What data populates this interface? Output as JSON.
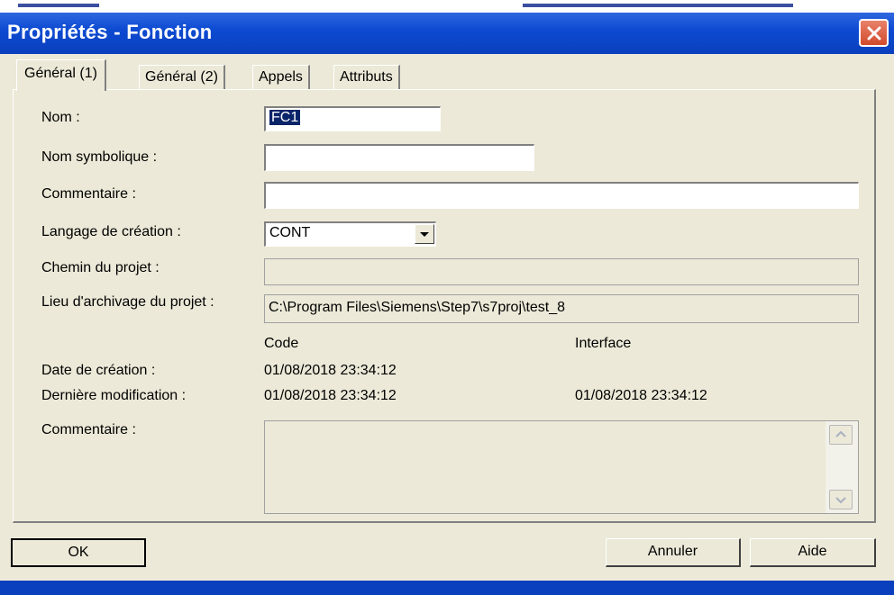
{
  "window": {
    "title": "Propriétés - Fonction"
  },
  "tabs": [
    "Général (1)",
    "Général (2)",
    "Appels",
    "Attributs"
  ],
  "form": {
    "nom_label": "Nom :",
    "nom_value": "FC1",
    "symbolique_label": "Nom symbolique :",
    "symbolique_value": "",
    "commentaire_label": "Commentaire :",
    "commentaire_value": "",
    "langage_label": "Langage de création :",
    "langage_value": "CONT",
    "chemin_label": "Chemin du projet :",
    "chemin_value": "",
    "lieu_label": "Lieu  d'archivage du projet :",
    "lieu_value": "C:\\Program Files\\Siemens\\Step7\\s7proj\\test_8",
    "col_code": "Code",
    "col_interface": "Interface",
    "date_creation_label": "Date de création :",
    "date_creation_code": "01/08/2018 23:34:12",
    "derniere_mod_label": "Dernière modification :",
    "derniere_mod_code": "01/08/2018 23:34:12",
    "derniere_mod_interface": "01/08/2018 23:34:12",
    "commentaire2_label": "Commentaire :",
    "commentaire2_value": ""
  },
  "buttons": {
    "ok": "OK",
    "cancel": "Annuler",
    "help": "Aide"
  },
  "colors": {
    "titlebar": "#0a3fbd",
    "dialog_bg": "#ece9d8",
    "close": "#d24a2c"
  },
  "icons": {
    "close": "close-icon",
    "dropdown": "chevron-down-icon",
    "scroll_up": "scroll-up-icon",
    "scroll_down": "scroll-down-icon"
  }
}
